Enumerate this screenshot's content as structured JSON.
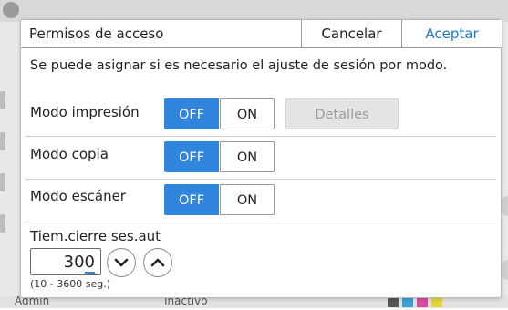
{
  "dialog": {
    "title": "Permisos de acceso",
    "cancel_label": "Cancelar",
    "accept_label": "Aceptar",
    "description": "Se puede asignar si es necesario el ajuste de sesión por modo."
  },
  "modes": [
    {
      "label": "Modo impresión",
      "off_label": "OFF",
      "on_label": "ON",
      "selected": "OFF",
      "details_label": "Detalles"
    },
    {
      "label": "Modo copia",
      "off_label": "OFF",
      "on_label": "ON",
      "selected": "OFF"
    },
    {
      "label": "Modo escáner",
      "off_label": "OFF",
      "on_label": "ON",
      "selected": "OFF"
    }
  ],
  "timeout": {
    "label": "Tiem.cierre ses.aut",
    "value": "300",
    "range": "(10 - 3600 seg.)"
  },
  "background": {
    "user": "Admin",
    "state": "Inactivo"
  },
  "colors": {
    "accent": "#2f86dc",
    "accept_text": "#1d79c7",
    "disabled_bg": "#e4e4e4"
  },
  "icons": {
    "down": "chevron-down-icon",
    "up": "chevron-up-icon",
    "gear": "gear-icon"
  }
}
